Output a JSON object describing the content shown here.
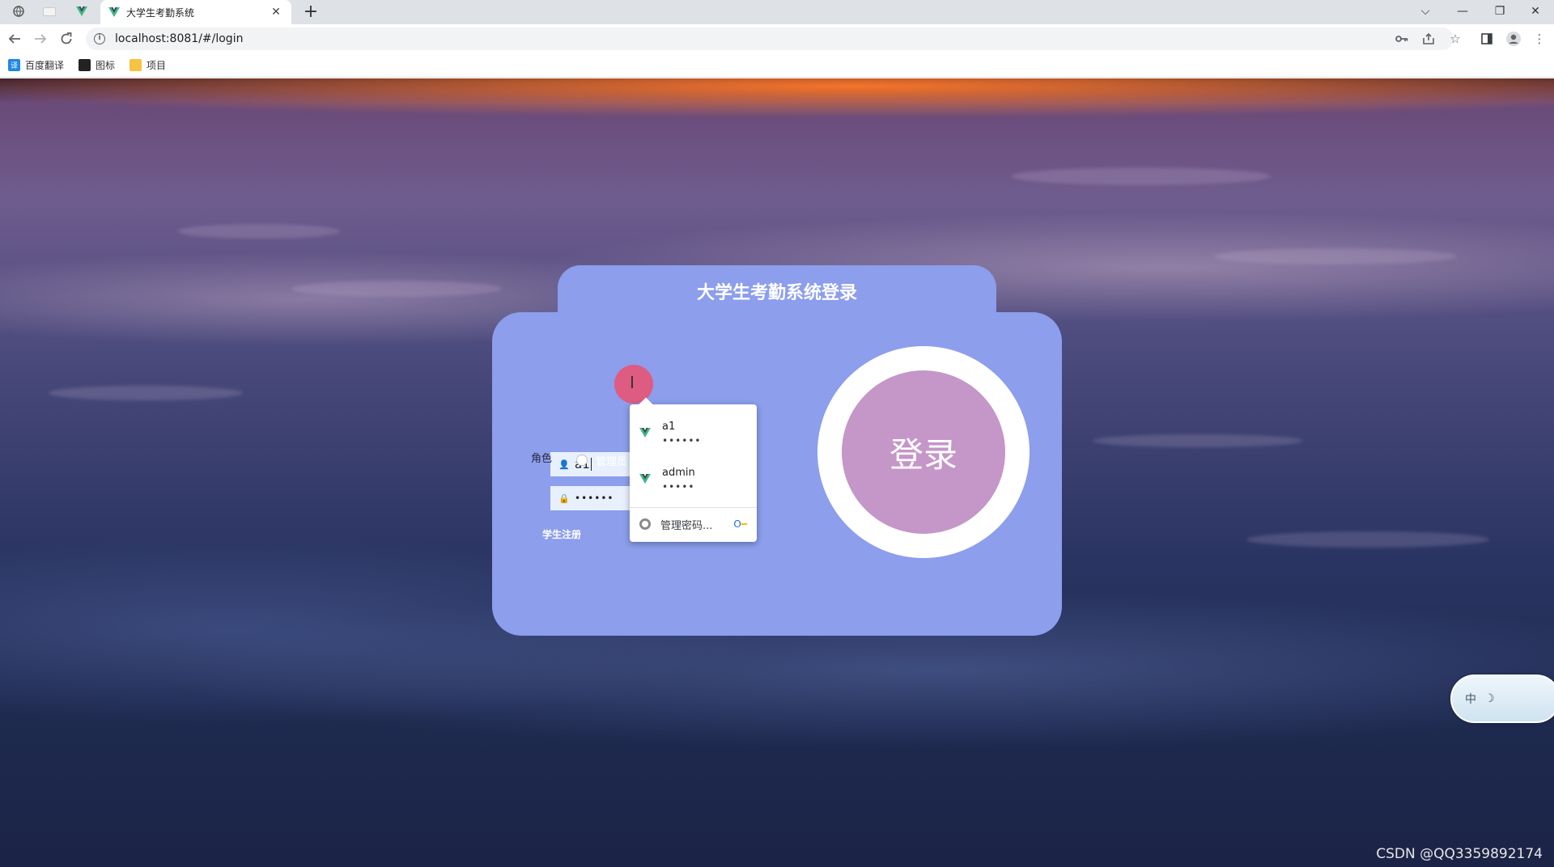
{
  "browser": {
    "tab_title": "大学生考勤系统",
    "url": "localhost:8081/#/login",
    "bookmarks": [
      {
        "label": "百度翻译",
        "icon": "translate-icon",
        "color": "#1e88e5"
      },
      {
        "label": "图标",
        "icon": "image-icon",
        "color": "#222222"
      },
      {
        "label": "项目",
        "icon": "folder-icon",
        "color": "#f6c342"
      }
    ]
  },
  "login": {
    "title": "大学生考勤系统登录",
    "username_value": "a1",
    "password_masked": "••••••",
    "role_label": "角色",
    "role_option": "管理员",
    "register_link": "学生注册",
    "login_button": "登录"
  },
  "autofill": {
    "suggestions": [
      {
        "username": "a1",
        "password_mask": "••••••"
      },
      {
        "username": "admin",
        "password_mask": "•••••"
      }
    ],
    "manage_label": "管理密码..."
  },
  "ime": {
    "label": "中"
  },
  "watermark": "CSDN @QQ3359892174",
  "colors": {
    "card": "#8c9eec",
    "login_button": "#c596c8",
    "autofill_field": "#e8f0fe",
    "vue_green": "#41b883"
  }
}
